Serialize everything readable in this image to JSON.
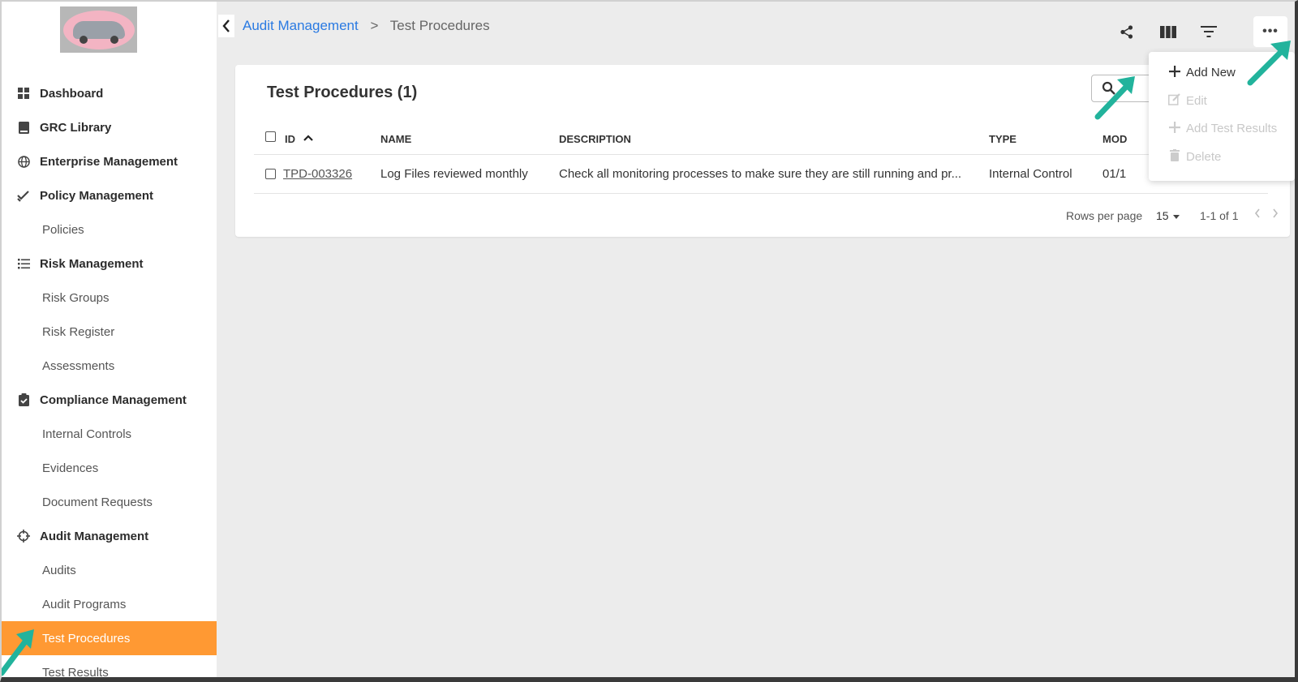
{
  "breadcrumb": {
    "parent": "Audit Management",
    "separator": ">",
    "current": "Test Procedures"
  },
  "sidebar": {
    "items": [
      {
        "label": "Dashboard",
        "icon": "dashboard-icon"
      },
      {
        "label": "GRC Library",
        "icon": "book-icon"
      },
      {
        "label": "Enterprise Management",
        "icon": "globe-icon"
      },
      {
        "label": "Policy Management",
        "icon": "double-check-icon"
      },
      {
        "label": "Policies"
      },
      {
        "label": "Risk Management",
        "icon": "list-icon"
      },
      {
        "label": "Risk Groups"
      },
      {
        "label": "Risk Register"
      },
      {
        "label": "Assessments"
      },
      {
        "label": "Compliance Management",
        "icon": "clipboard-check-icon"
      },
      {
        "label": "Internal Controls"
      },
      {
        "label": "Evidences"
      },
      {
        "label": "Document Requests"
      },
      {
        "label": "Audit Management",
        "icon": "crosshair-icon"
      },
      {
        "label": "Audits"
      },
      {
        "label": "Audit Programs"
      },
      {
        "label": "Test Procedures",
        "active": true
      },
      {
        "label": "Test Results"
      }
    ]
  },
  "toolbar": {
    "icons": [
      "share-icon",
      "columns-icon",
      "filter-icon",
      "more-icon"
    ],
    "more_label": "•••"
  },
  "card": {
    "title": "Test Procedures (1)"
  },
  "table": {
    "columns": [
      "ID",
      "NAME",
      "DESCRIPTION",
      "TYPE",
      "MOD"
    ],
    "sort_indicator": "^",
    "rows": [
      {
        "id": "TPD-003326",
        "name": "Log Files reviewed monthly",
        "description": "Check all monitoring processes to make sure they are still running and pr...",
        "type": "Internal Control",
        "modified": "01/1"
      }
    ]
  },
  "pagination": {
    "rows_per_page_label": "Rows per page",
    "rows_per_page_value": "15",
    "range": "1-1 of 1"
  },
  "menu": {
    "items": [
      {
        "label": "Add New",
        "icon": "plus-icon",
        "enabled": true
      },
      {
        "label": "Edit",
        "icon": "edit-icon",
        "enabled": false
      },
      {
        "label": "Add Test Results",
        "icon": "plus-icon",
        "enabled": false
      },
      {
        "label": "Delete",
        "icon": "trash-icon",
        "enabled": false
      }
    ]
  },
  "colors": {
    "accent": "#ff9933",
    "link": "#2a7ae2",
    "annotation_arrow": "#22b39c",
    "background": "#ececec"
  }
}
